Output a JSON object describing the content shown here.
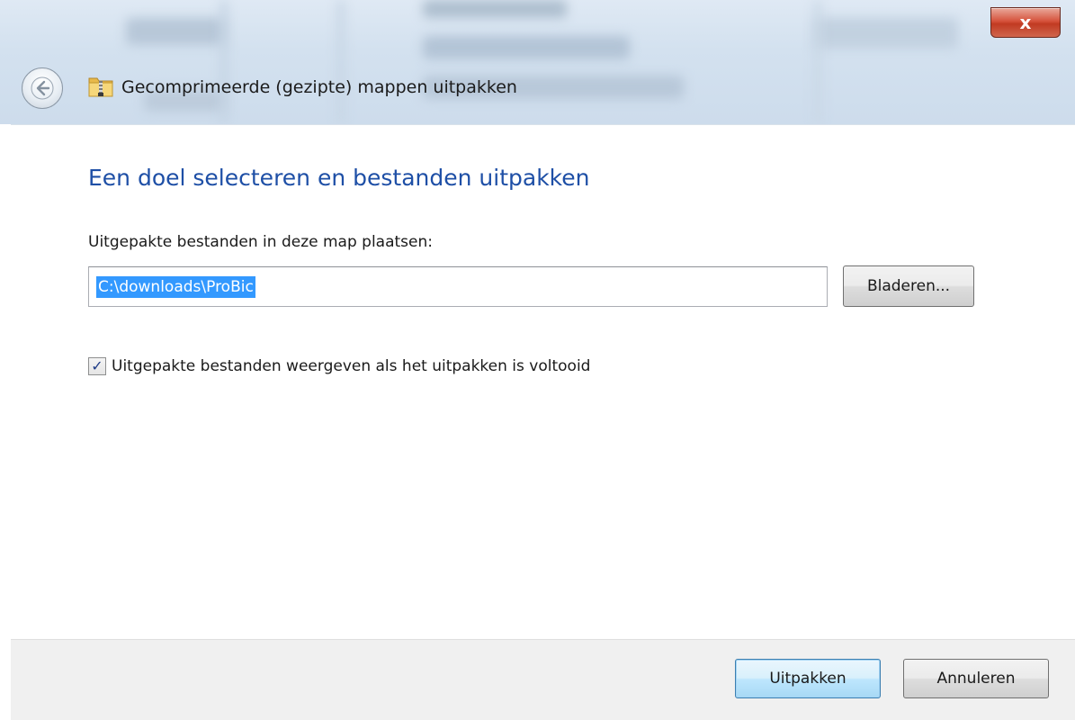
{
  "window": {
    "title": "Gecomprimeerde (gezipte) mappen uitpakken",
    "close_label": "x"
  },
  "main": {
    "heading": "Een doel selecteren en bestanden uitpakken",
    "destination_label": "Uitgepakte bestanden in deze map plaatsen:",
    "destination_value": "C:\\downloads\\ProBic",
    "browse_label": "Bladeren...",
    "show_files_checkbox": {
      "label": "Uitgepakte bestanden weergeven als het uitpakken is voltooid",
      "checked": true
    }
  },
  "footer": {
    "extract_label": "Uitpakken",
    "cancel_label": "Annuleren"
  },
  "colors": {
    "heading": "#1e4fa6",
    "selection": "#3399ff",
    "close_button": "#c13a22"
  }
}
